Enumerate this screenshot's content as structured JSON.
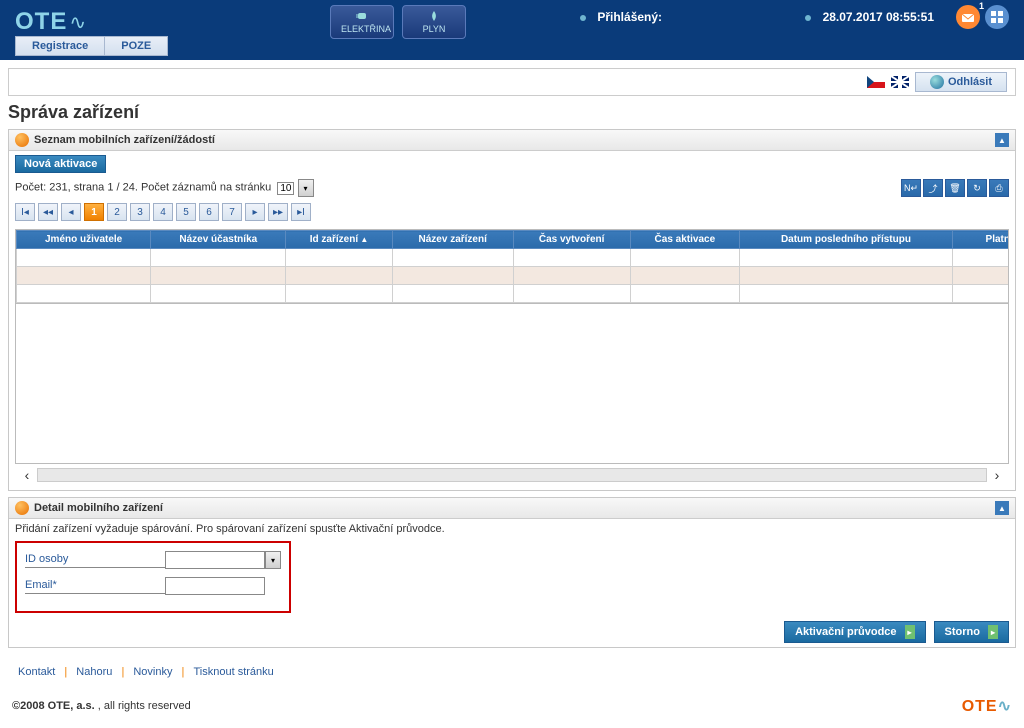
{
  "header": {
    "logo": "OTE",
    "nav_electricity": "ELEKTŘINA",
    "nav_gas": "PLYN",
    "logged_label": "Přihlášený:",
    "datetime": "28.07.2017 08:55:51",
    "mail_badge": "1",
    "subnav_registration": "Registrace",
    "subnav_poze": "POZE",
    "logout": "Odhlásit"
  },
  "page": {
    "title": "Správa zařízení"
  },
  "list_panel": {
    "title": "Seznam mobilních zařízení/žádostí",
    "new_activation": "Nová aktivace",
    "count_prefix": "Počet: 231, strana 1 / 24. ",
    "count_per_page": "Počet záznamů na stránku",
    "per_page_value": "10",
    "pages": [
      "1",
      "2",
      "3",
      "4",
      "5",
      "6",
      "7"
    ],
    "columns": {
      "user_name": "Jméno uživatele",
      "participant": "Název účastníka",
      "device_id": "Id zařízení",
      "device_name": "Název zařízení",
      "created": "Čas vytvoření",
      "activated": "Čas aktivace",
      "last_access": "Datum posledního přístupu",
      "auth_valid": "Platnost autentizace"
    }
  },
  "detail_panel": {
    "title": "Detail mobilního zařízení",
    "hint": "Přidání zařízení vyžaduje spárování. Pro spárovaní zařízení spusťte Aktivační průvodce.",
    "id_person": "ID osoby",
    "email": "Email*",
    "wizard_btn": "Aktivační průvodce",
    "cancel_btn": "Storno"
  },
  "footer": {
    "contact": "Kontakt",
    "top": "Nahoru",
    "news": "Novinky",
    "print": "Tisknout stránku",
    "copy": "©2008 OTE, a.s.",
    "rights": ", all rights reserved",
    "logo": "OTE"
  }
}
